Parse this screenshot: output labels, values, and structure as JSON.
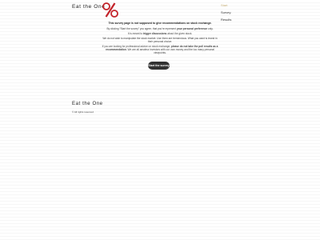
{
  "header": {
    "site_title": "Eat the One",
    "logo_glyph": "%",
    "logo_color": "#c3232a"
  },
  "nav": {
    "items": [
      {
        "label": "Start",
        "active": true
      },
      {
        "label": "Survey",
        "active": false
      },
      {
        "label": "Results",
        "active": false
      }
    ],
    "active_color": "#c9b27a"
  },
  "main": {
    "notice": "This survey page is not supposed to give recommendations on stock exchange.",
    "para1_a": "By clicking \"Start the survey\" you agree, that you're represent ",
    "para1_b": "your personal preference",
    "para1_c": " only.",
    "para2_a": "It is meant to ",
    "para2_b": "trigger discussions",
    "para2_c": " about the given stock.",
    "para3": "We do not wish to manipulate the stock market. Use them are tremendous. What you want is invest in their personal choice.",
    "para4_a": "If you are looking for professional advice on stock exchange, ",
    "para4_b": "please do not take the poll results as a recommendation",
    "para4_c": ". We are all amateur investors with our own money and the too many personal viewpoints.",
    "start_button": "Start the survey"
  },
  "footer": {
    "site_title": "Eat the One",
    "copyright": "© All rights reserved"
  }
}
